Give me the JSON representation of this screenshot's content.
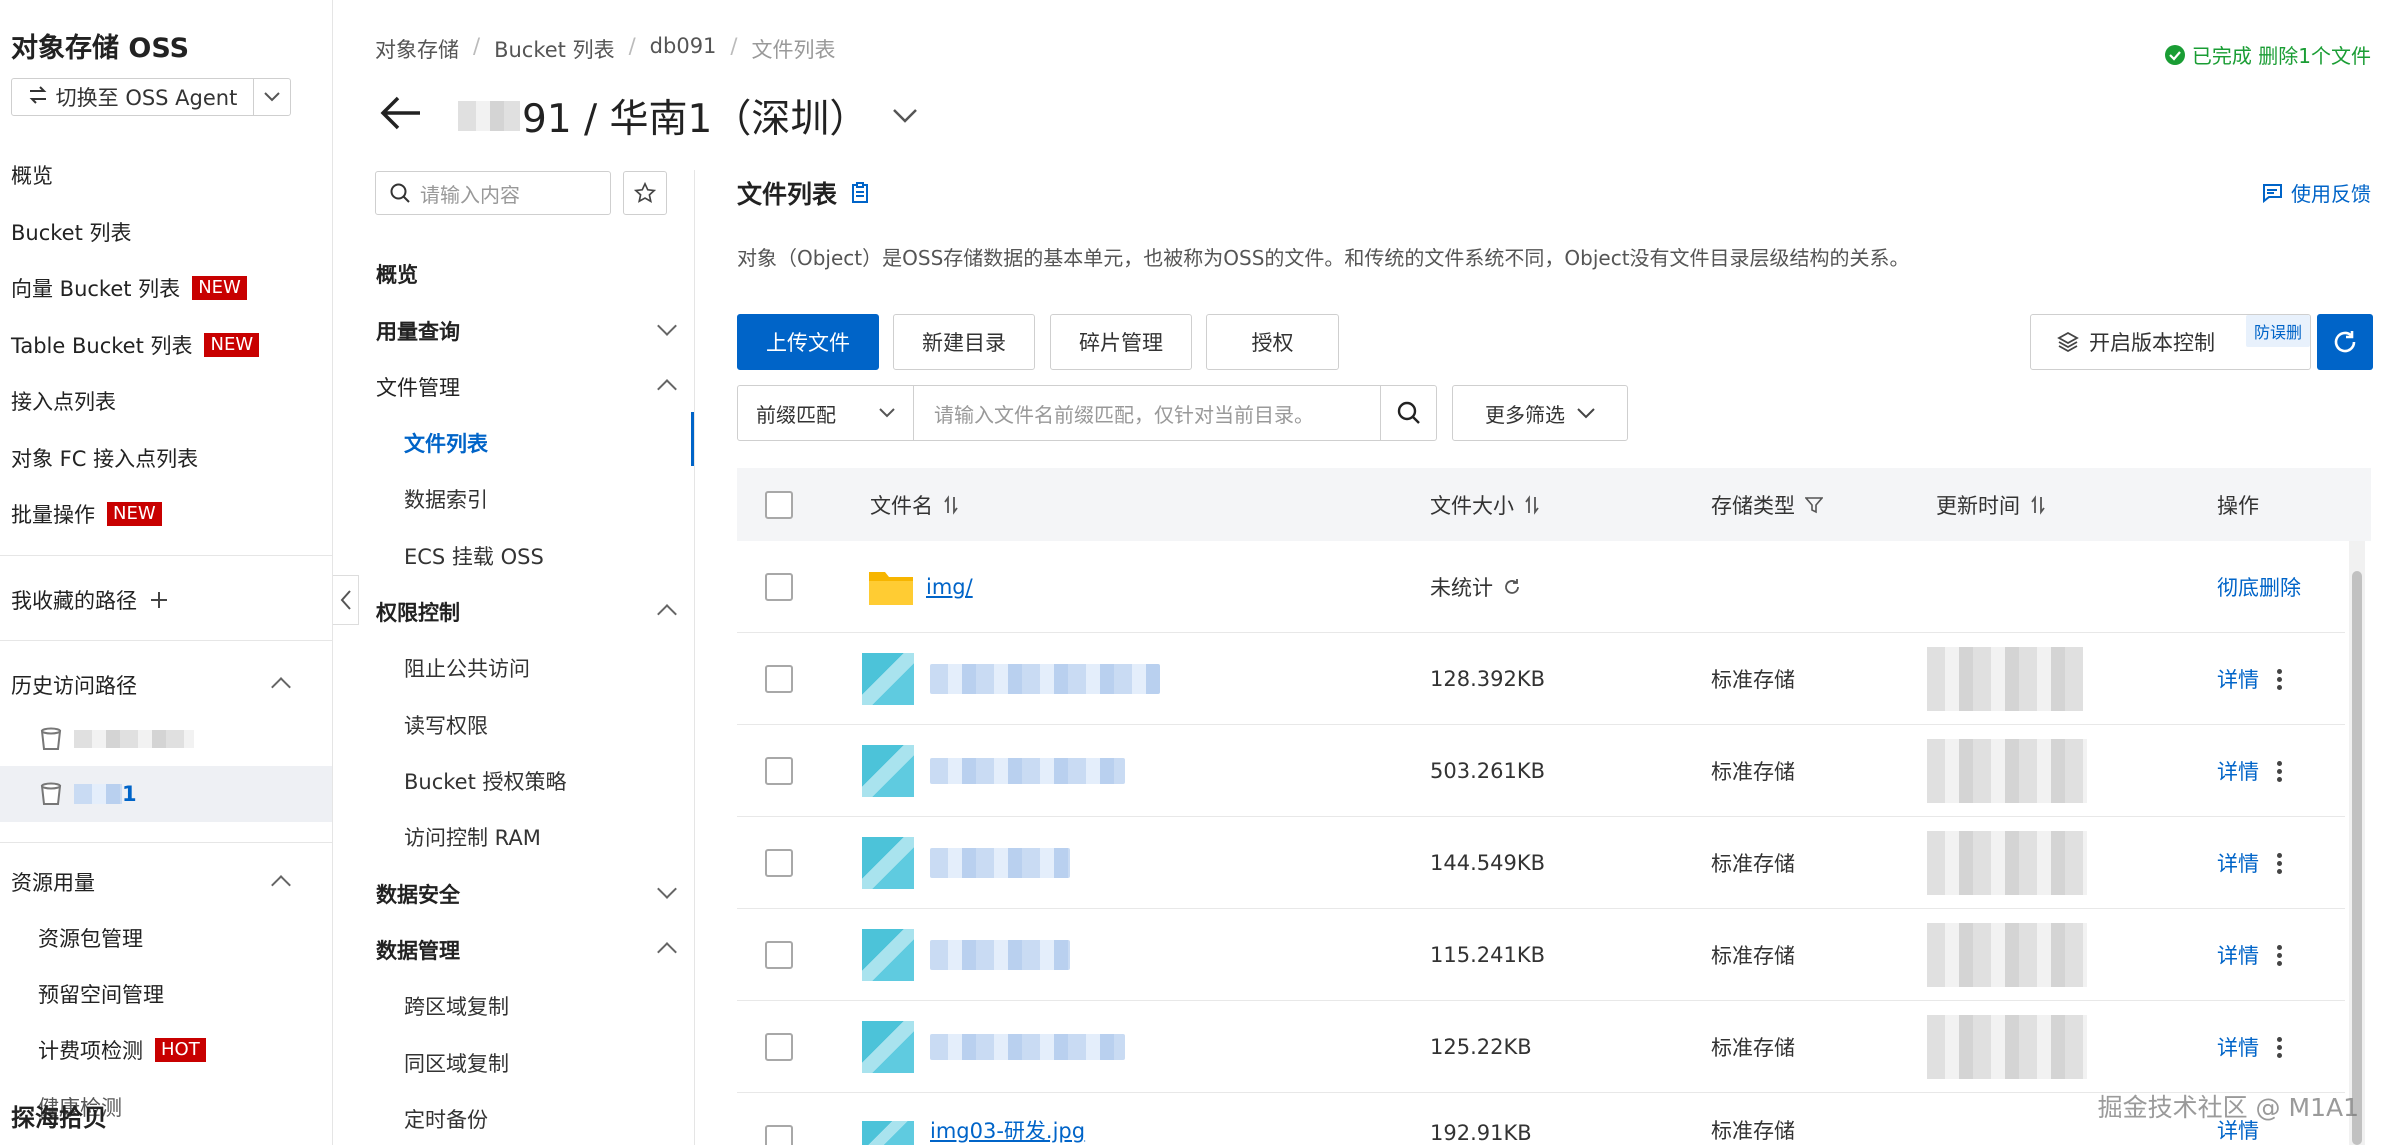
{
  "sidebar": {
    "title": "对象存储 OSS",
    "agent_button": "切换至 OSS Agent",
    "items": [
      {
        "label": "概览",
        "badge": ""
      },
      {
        "label": "Bucket 列表",
        "badge": ""
      },
      {
        "label": "向量 Bucket 列表",
        "badge": "NEW"
      },
      {
        "label": "Table Bucket 列表",
        "badge": "NEW"
      },
      {
        "label": "接入点列表",
        "badge": ""
      },
      {
        "label": "对象 FC 接入点列表",
        "badge": ""
      },
      {
        "label": "批量操作",
        "badge": "NEW"
      }
    ],
    "favorites_label": "我收藏的路径",
    "history_label": "历史访问路径",
    "history_item_2": "1",
    "resources_label": "资源用量",
    "resource_items": [
      {
        "label": "资源包管理",
        "badge": ""
      },
      {
        "label": "预留空间管理",
        "badge": ""
      },
      {
        "label": "计费项检测",
        "badge": "HOT"
      },
      {
        "label": "健康检测",
        "badge": ""
      }
    ],
    "explore_label": "探海拾贝"
  },
  "header": {
    "breadcrumb": [
      "对象存储",
      "Bucket 列表",
      "db091",
      "文件列表"
    ],
    "bucket_suffix": "91 / 华南1（深圳）",
    "status": "已完成 删除1个文件"
  },
  "nav2": {
    "search_placeholder": "请输入内容",
    "overview": "概览",
    "usage": "用量查询",
    "file_mgmt": "文件管理",
    "file_list": "文件列表",
    "data_index": "数据索引",
    "ecs_mount": "ECS 挂载 OSS",
    "access_ctrl": "权限控制",
    "block_public": "阻止公共访问",
    "rw_perm": "读写权限",
    "bucket_policy": "Bucket 授权策略",
    "ram": "访问控制 RAM",
    "data_security": "数据安全",
    "data_mgmt": "数据管理",
    "cross_region": "跨区域复制",
    "same_region": "同区域复制",
    "backup": "定时备份"
  },
  "main": {
    "title": "文件列表",
    "feedback": "使用反馈",
    "description": "对象（Object）是OSS存储数据的基本单元，也被称为OSS的文件。和传统的文件系统不同，Object没有文件目录层级结构的关系。",
    "buttons": {
      "upload": "上传文件",
      "new_dir": "新建目录",
      "fragments": "碎片管理",
      "authorize": "授权"
    },
    "version_control": "开启版本控制",
    "version_tag": "防误删",
    "filter_select": "前缀匹配",
    "filter_placeholder": "请输入文件名前缀匹配，仅针对当前目录。",
    "more_filter": "更多筛选",
    "columns": {
      "name": "文件名",
      "size": "文件大小",
      "storage": "存储类型",
      "updated": "更新时间",
      "action": "操作"
    },
    "folder": {
      "name": "img/",
      "size": "未统计",
      "action": "彻底删除"
    },
    "rows": [
      {
        "size": "128.392KB",
        "storage": "标准存储",
        "action": "详情"
      },
      {
        "size": "503.261KB",
        "storage": "标准存储",
        "action": "详情"
      },
      {
        "size": "144.549KB",
        "storage": "标准存储",
        "action": "详情"
      },
      {
        "size": "115.241KB",
        "storage": "标准存储",
        "action": "详情"
      },
      {
        "size": "125.22KB",
        "storage": "标准存储",
        "action": "详情"
      },
      {
        "name": "img03-研发.jpg",
        "size": "192.91KB",
        "storage": "标准存储",
        "action": "详情"
      }
    ]
  },
  "watermark": "掘金技术社区 @ M1A1",
  "colors": {
    "accent": "#0064c8",
    "badge": "#c80000",
    "success": "#1a9d34"
  }
}
